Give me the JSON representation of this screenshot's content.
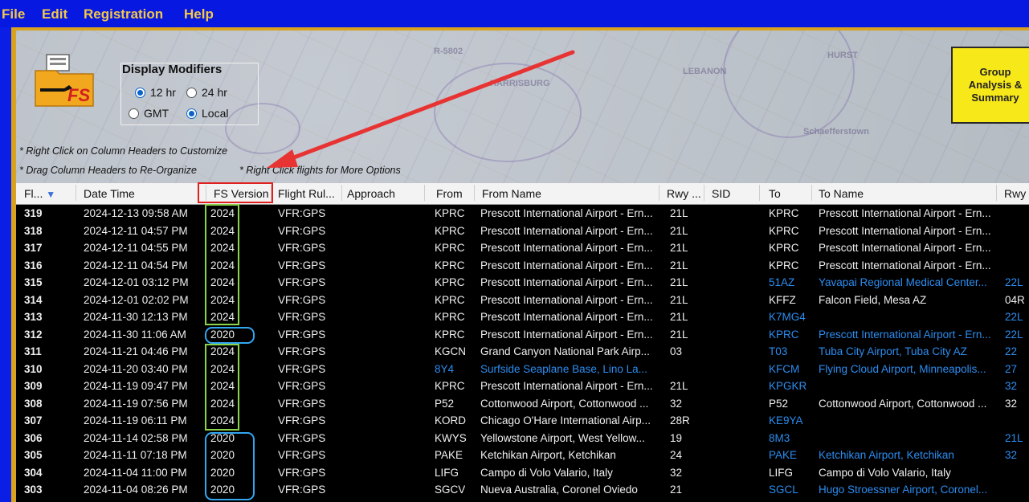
{
  "menu": [
    "File",
    "Edit",
    "Registration",
    "Help"
  ],
  "display_modifiers": {
    "title": "Display Modifiers",
    "options": [
      {
        "label": "12 hr",
        "checked": true
      },
      {
        "label": "24 hr",
        "checked": false
      },
      {
        "label": "GMT",
        "checked": false
      },
      {
        "label": "Local",
        "checked": true
      }
    ]
  },
  "hints": [
    "* Right Click on Column Headers to Customize",
    "* Drag Column Headers to Re-Organize",
    "* Right Click flights for More Options"
  ],
  "group_button": {
    "line1": "Group",
    "line2": "Analysis &",
    "line3": "Summary"
  },
  "logo": {
    "text": "FS"
  },
  "columns": [
    "Fl...",
    "Date Time",
    "FS Version",
    "Flight Rul...",
    "Approach",
    "From",
    "From Name",
    "Rwy ...",
    "SID",
    "To",
    "To Name",
    "Rwy ..."
  ],
  "sort_indicator": "▼",
  "rows": [
    {
      "flight": "319",
      "datetime": "2024-12-13  09:58 AM",
      "version": "2024",
      "rules": "VFR:GPS",
      "from": "KPRC",
      "from_name": "Prescott International Airport - Ern...",
      "rwy": "21L",
      "to": "KPRC",
      "to_name": "Prescott International Airport - Ern...",
      "to_rwy": "",
      "to_link": false,
      "from_link": false
    },
    {
      "flight": "318",
      "datetime": "2024-12-11  04:57 PM",
      "version": "2024",
      "rules": "VFR:GPS",
      "from": "KPRC",
      "from_name": "Prescott International Airport - Ern...",
      "rwy": "21L",
      "to": "KPRC",
      "to_name": "Prescott International Airport - Ern...",
      "to_rwy": "",
      "to_link": false,
      "from_link": false
    },
    {
      "flight": "317",
      "datetime": "2024-12-11  04:55 PM",
      "version": "2024",
      "rules": "VFR:GPS",
      "from": "KPRC",
      "from_name": "Prescott International Airport - Ern...",
      "rwy": "21L",
      "to": "KPRC",
      "to_name": "Prescott International Airport - Ern...",
      "to_rwy": "",
      "to_link": false,
      "from_link": false
    },
    {
      "flight": "316",
      "datetime": "2024-12-11  04:54 PM",
      "version": "2024",
      "rules": "VFR:GPS",
      "from": "KPRC",
      "from_name": "Prescott International Airport - Ern...",
      "rwy": "21L",
      "to": "KPRC",
      "to_name": "Prescott International Airport - Ern...",
      "to_rwy": "",
      "to_link": false,
      "from_link": false
    },
    {
      "flight": "315",
      "datetime": "2024-12-01  03:12 PM",
      "version": "2024",
      "rules": "VFR:GPS",
      "from": "KPRC",
      "from_name": "Prescott International Airport - Ern...",
      "rwy": "21L",
      "to": "51AZ",
      "to_name": "Yavapai Regional Medical Center...",
      "to_rwy": "22L",
      "to_link": true,
      "from_link": false
    },
    {
      "flight": "314",
      "datetime": "2024-12-01  02:02 PM",
      "version": "2024",
      "rules": "VFR:GPS",
      "from": "KPRC",
      "from_name": "Prescott International Airport - Ern...",
      "rwy": "21L",
      "to": "KFFZ",
      "to_name": "Falcon Field,  Mesa AZ",
      "to_rwy": "04R",
      "to_link": false,
      "from_link": false
    },
    {
      "flight": "313",
      "datetime": "2024-11-30  12:13 PM",
      "version": "2024",
      "rules": "VFR:GPS",
      "from": "KPRC",
      "from_name": "Prescott International Airport - Ern...",
      "rwy": "21L",
      "to": "K7MG4",
      "to_name": "",
      "to_rwy": "22L",
      "to_link": true,
      "from_link": false
    },
    {
      "flight": "312",
      "datetime": "2024-11-30  11:06 AM",
      "version": "2020",
      "rules": "VFR:GPS",
      "from": "KPRC",
      "from_name": "Prescott International Airport - Ern...",
      "rwy": "21L",
      "to": "KPRC",
      "to_name": "Prescott International Airport - Ern...",
      "to_rwy": "22L",
      "to_link": true,
      "from_link": false
    },
    {
      "flight": "311",
      "datetime": "2024-11-21  04:46 PM",
      "version": "2024",
      "rules": "VFR:GPS",
      "from": "KGCN",
      "from_name": "Grand Canyon National Park Airp...",
      "rwy": "03",
      "to": "T03",
      "to_name": "Tuba City Airport,  Tuba City AZ",
      "to_rwy": "22",
      "to_link": true,
      "from_link": false
    },
    {
      "flight": "310",
      "datetime": "2024-11-20  03:40 PM",
      "version": "2024",
      "rules": "VFR:GPS",
      "from": "8Y4",
      "from_name": "Surfside Seaplane Base,  Lino La...",
      "rwy": "",
      "to": "KFCM",
      "to_name": "Flying Cloud Airport,  Minneapolis...",
      "to_rwy": "27",
      "to_link": true,
      "from_link": true
    },
    {
      "flight": "309",
      "datetime": "2024-11-19  09:47 PM",
      "version": "2024",
      "rules": "VFR:GPS",
      "from": "KPRC",
      "from_name": "Prescott International Airport - Ern...",
      "rwy": "21L",
      "to": "KPGKR",
      "to_name": "",
      "to_rwy": "32",
      "to_link": true,
      "from_link": false
    },
    {
      "flight": "308",
      "datetime": "2024-11-19  07:56 PM",
      "version": "2024",
      "rules": "VFR:GPS",
      "from": "P52",
      "from_name": "Cottonwood Airport,  Cottonwood ...",
      "rwy": "32",
      "to": "P52",
      "to_name": "Cottonwood Airport,  Cottonwood ...",
      "to_rwy": "32",
      "to_link": false,
      "from_link": false
    },
    {
      "flight": "307",
      "datetime": "2024-11-19  06:11 PM",
      "version": "2024",
      "rules": "VFR:GPS",
      "from": "KORD",
      "from_name": "Chicago O'Hare International Airp...",
      "rwy": "28R",
      "to": "KE9YA",
      "to_name": "",
      "to_rwy": "",
      "to_link": true,
      "from_link": false
    },
    {
      "flight": "306",
      "datetime": "2024-11-14  02:58 PM",
      "version": "2020",
      "rules": "VFR:GPS",
      "from": "KWYS",
      "from_name": "Yellowstone Airport,  West Yellow...",
      "rwy": "19",
      "to": "8M3",
      "to_name": "",
      "to_rwy": "21L",
      "to_link": true,
      "from_link": false
    },
    {
      "flight": "305",
      "datetime": "2024-11-11  07:18 PM",
      "version": "2020",
      "rules": "VFR:GPS",
      "from": "PAKE",
      "from_name": "Ketchikan Airport,  Ketchikan",
      "rwy": "24",
      "to": "PAKE",
      "to_name": "Ketchikan Airport,  Ketchikan",
      "to_rwy": "32",
      "to_link": true,
      "from_link": false
    },
    {
      "flight": "304",
      "datetime": "2024-11-04  11:00 PM",
      "version": "2020",
      "rules": "VFR:GPS",
      "from": "LIFG",
      "from_name": "Campo di Volo Valario,  Italy",
      "rwy": "32",
      "to": "LIFG",
      "to_name": "Campo di Volo Valario,  Italy",
      "to_rwy": "",
      "to_link": false,
      "from_link": false
    },
    {
      "flight": "303",
      "datetime": "2024-11-04  08:26 PM",
      "version": "2020",
      "rules": "VFR:GPS",
      "from": "SGCV",
      "from_name": "Nueva Australia,  Coronel Oviedo",
      "rwy": "21",
      "to": "SGCL",
      "to_name": "Hugo Stroessner Airport,  Coronel...",
      "to_rwy": "",
      "to_link": true,
      "from_link": false
    }
  ]
}
